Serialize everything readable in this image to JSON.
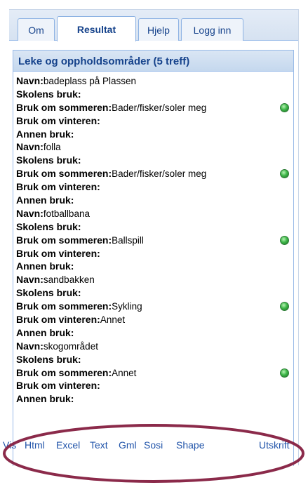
{
  "tabs": [
    {
      "label": "Om",
      "active": false
    },
    {
      "label": "Resultat",
      "active": true
    },
    {
      "label": "Hjelp",
      "active": false
    },
    {
      "label": "Logg inn",
      "active": false
    }
  ],
  "panel": {
    "title": "Leke og oppholdsområder (5 treff)"
  },
  "results": [
    {
      "navn": "badeplass på Plassen",
      "skolens_bruk": "",
      "sommer": "Bader/fisker/soler meg",
      "vinter": "",
      "annen": ""
    },
    {
      "navn": "folla",
      "skolens_bruk": "",
      "sommer": "Bader/fisker/soler meg",
      "vinter": "",
      "annen": ""
    },
    {
      "navn": "fotballbana",
      "skolens_bruk": "",
      "sommer": "Ballspill",
      "vinter": "",
      "annen": ""
    },
    {
      "navn": "sandbakken",
      "skolens_bruk": "",
      "sommer": "Sykling",
      "vinter": "Annet",
      "annen": ""
    },
    {
      "navn": "skogområdet",
      "skolens_bruk": "",
      "sommer": "Annet",
      "vinter": "",
      "annen": ""
    }
  ],
  "labels": {
    "navn": "Navn:",
    "skolens_bruk": "Skolens bruk:",
    "sommer": "Bruk om sommeren:",
    "vinter": "Bruk om vinteren:",
    "annen": "Annen bruk:"
  },
  "footer": [
    "Vis",
    "Html",
    "Excel",
    "Text",
    "Gml",
    "Sosi",
    "Shape",
    "Utskrift"
  ],
  "colors": {
    "header_text": "#15428b",
    "link": "#2255aa",
    "highlight_ellipse": "#8b2a4a",
    "status_dot": "#3fb84a"
  },
  "icons": {
    "status": "green-dot-icon"
  }
}
